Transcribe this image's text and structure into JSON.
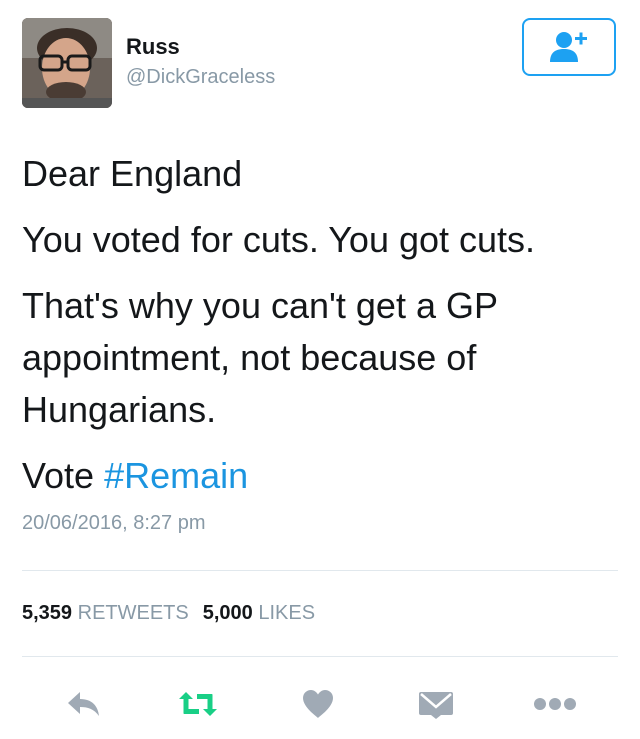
{
  "user": {
    "name": "Russ",
    "handle": "@DickGraceless"
  },
  "follow_button": {
    "icon": "add-user-icon"
  },
  "tweet": {
    "line1": "Dear England",
    "line2": "You voted for cuts. You got cuts.",
    "line3": "That's why you can't get a GP appointment, not because of Hungarians.",
    "line4_prefix": "Vote ",
    "hashtag": "#Remain"
  },
  "timestamp": "20/06/2016, 8:27 pm",
  "stats": {
    "retweets_count": "5,359",
    "retweets_label": "RETWEETS",
    "likes_count": "5,000",
    "likes_label": "LIKES"
  },
  "actions": [
    {
      "icon": "reply-icon"
    },
    {
      "icon": "retweet-icon"
    },
    {
      "icon": "heart-icon"
    },
    {
      "icon": "direct-message-icon"
    },
    {
      "icon": "more-icon"
    }
  ],
  "colors": {
    "accent": "#1da1f2",
    "hashtag": "#1b95e0",
    "retweet_green": "#19cf86",
    "muted": "#8899a6",
    "icon_gray": "#a0aab5"
  }
}
